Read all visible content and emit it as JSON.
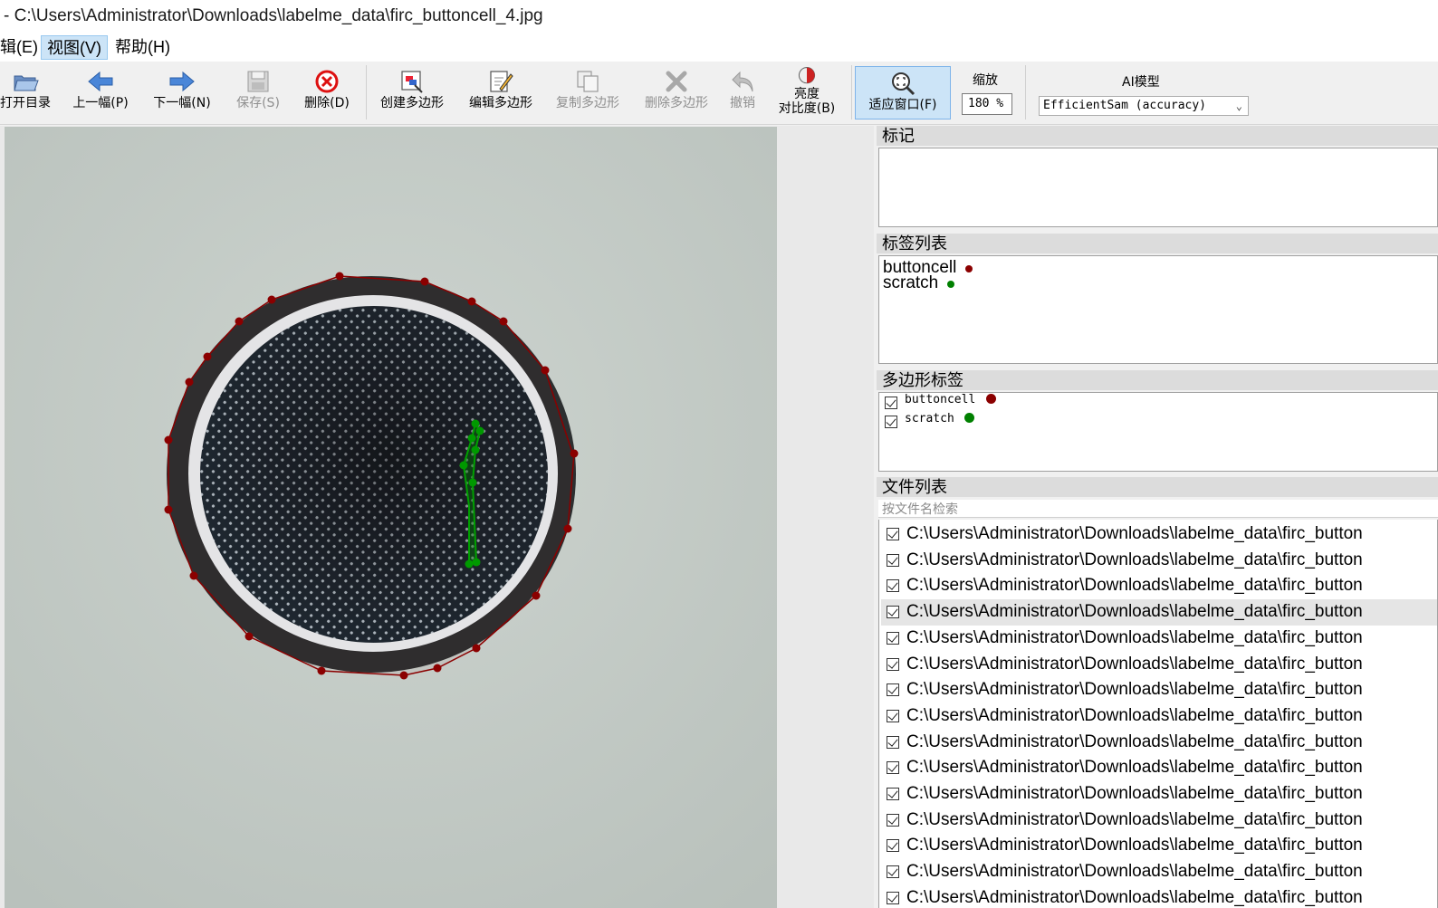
{
  "window": {
    "title": "- C:\\Users\\Administrator\\Downloads\\labelme_data\\firc_buttoncell_4.jpg"
  },
  "menu": {
    "items": [
      {
        "label": "辑(E)"
      },
      {
        "label": "视图(V)",
        "active": true
      },
      {
        "label": "帮助(H)"
      }
    ]
  },
  "toolbar": {
    "open_dir": "打开目录",
    "prev": "上一幅(P)",
    "next": "下一幅(N)",
    "save": "保存(S)",
    "delete": "删除(D)",
    "create_polygon": "创建多边形",
    "edit_polygon": "编辑多边形",
    "copy_polygon": "复制多边形",
    "delete_polygon": "删除多边形",
    "undo": "撤销",
    "brightness_line1": "亮度",
    "brightness_line2": "对比度(B)",
    "fit_window": "适应窗口(F)",
    "zoom_label": "缩放",
    "zoom_value": "180 %",
    "ai_model_label": "AI模型",
    "ai_model_value": "EfficientSam (accuracy)"
  },
  "docks": {
    "flags": {
      "title": "标记"
    },
    "label_list": {
      "title": "标签列表",
      "items": [
        {
          "label": "buttoncell",
          "color": "#8b0000"
        },
        {
          "label": "scratch",
          "color": "#008000"
        }
      ]
    },
    "polygon_labels": {
      "title": "多边形标签",
      "items": [
        {
          "label": "buttoncell",
          "color": "#8b0000",
          "checked": true
        },
        {
          "label": "scratch",
          "color": "#008000",
          "checked": true
        }
      ]
    },
    "file_list": {
      "title": "文件列表",
      "search_placeholder": "按文件名检索",
      "selected_index": 3,
      "items": [
        "C:\\Users\\Administrator\\Downloads\\labelme_data\\firc_button",
        "C:\\Users\\Administrator\\Downloads\\labelme_data\\firc_button",
        "C:\\Users\\Administrator\\Downloads\\labelme_data\\firc_button",
        "C:\\Users\\Administrator\\Downloads\\labelme_data\\firc_button",
        "C:\\Users\\Administrator\\Downloads\\labelme_data\\firc_button",
        "C:\\Users\\Administrator\\Downloads\\labelme_data\\firc_button",
        "C:\\Users\\Administrator\\Downloads\\labelme_data\\firc_button",
        "C:\\Users\\Administrator\\Downloads\\labelme_data\\firc_button",
        "C:\\Users\\Administrator\\Downloads\\labelme_data\\firc_button",
        "C:\\Users\\Administrator\\Downloads\\labelme_data\\firc_button",
        "C:\\Users\\Administrator\\Downloads\\labelme_data\\firc_button",
        "C:\\Users\\Administrator\\Downloads\\labelme_data\\firc_button",
        "C:\\Users\\Administrator\\Downloads\\labelme_data\\firc_button",
        "C:\\Users\\Administrator\\Downloads\\labelme_data\\firc_button",
        "C:\\Users\\Administrator\\Downloads\\labelme_data\\firc_button"
      ]
    }
  },
  "colors": {
    "buttoncell": "#8b0000",
    "scratch": "#008000",
    "accent": "#cce4f7"
  }
}
